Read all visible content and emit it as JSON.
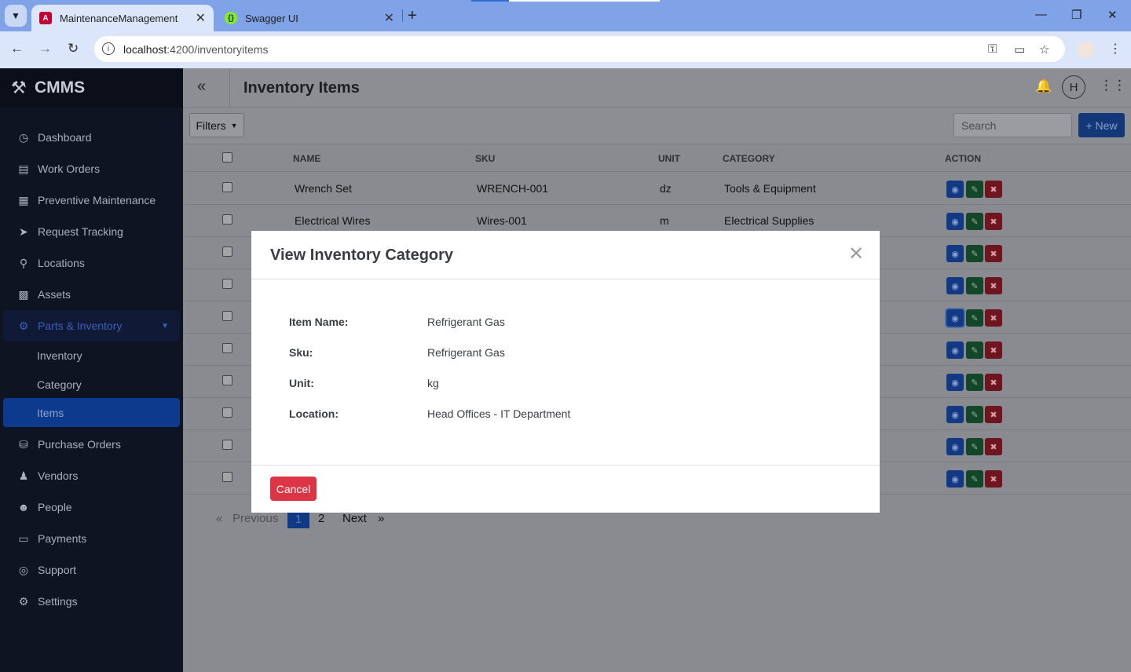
{
  "browser": {
    "tabs": [
      {
        "label": "MaintenanceManagement",
        "icon": "angular-icon"
      },
      {
        "label": "Swagger UI",
        "icon": "swagger-icon"
      }
    ],
    "url_host": "localhost",
    "url_rest": ":4200/inventoryitems"
  },
  "app": {
    "brand": "CMMS",
    "page_title": "Inventory Items",
    "avatar_initial": "H",
    "filters_label": "Filters",
    "search_placeholder": "Search",
    "new_label": "+ New"
  },
  "sidebar": {
    "items": [
      {
        "label": "Dashboard",
        "icon": "gauge-icon"
      },
      {
        "label": "Work Orders",
        "icon": "clipboard-icon"
      },
      {
        "label": "Preventive Maintenance",
        "icon": "calendar-icon"
      },
      {
        "label": "Request Tracking",
        "icon": "send-icon"
      },
      {
        "label": "Locations",
        "icon": "map-pin-icon"
      },
      {
        "label": "Assets",
        "icon": "boxes-icon"
      },
      {
        "label": "Parts & Inventory",
        "icon": "parts-icon"
      },
      {
        "label": "Purchase Orders",
        "icon": "cart-icon"
      },
      {
        "label": "Vendors",
        "icon": "vendor-icon"
      },
      {
        "label": "People",
        "icon": "people-icon"
      },
      {
        "label": "Payments",
        "icon": "card-icon"
      },
      {
        "label": "Support",
        "icon": "lifebuoy-icon"
      },
      {
        "label": "Settings",
        "icon": "gear-icon"
      }
    ],
    "subitems": [
      {
        "label": "Inventory"
      },
      {
        "label": "Category"
      },
      {
        "label": "Items"
      }
    ]
  },
  "table": {
    "columns": [
      "NAME",
      "SKU",
      "UNIT",
      "CATEGORY",
      "ACTION"
    ],
    "rows": [
      {
        "name": "Wrench Set",
        "sku": "WRENCH-001",
        "unit": "dz",
        "category": "Tools & Equipment"
      },
      {
        "name": "Electrical Wires",
        "sku": "Wires-001",
        "unit": "m",
        "category": "Electrical Supplies"
      }
    ],
    "row_count": 10
  },
  "pagination": {
    "prev": "Previous",
    "pages": [
      "1",
      "2"
    ],
    "current": "1",
    "next": "Next"
  },
  "modal": {
    "title": "View Inventory Category",
    "fields": [
      {
        "label": "Item Name:",
        "value": "Refrigerant Gas"
      },
      {
        "label": "Sku:",
        "value": "Refrigerant Gas"
      },
      {
        "label": "Unit:",
        "value": "kg"
      },
      {
        "label": "Location:",
        "value": "Head Offices - IT Department"
      }
    ],
    "cancel_label": "Cancel"
  },
  "colors": {
    "sidebar_bg": "#0f1422",
    "primary": "#0d6efd",
    "success": "#198754",
    "danger": "#dc3545",
    "overlay": "#8a8b90"
  }
}
